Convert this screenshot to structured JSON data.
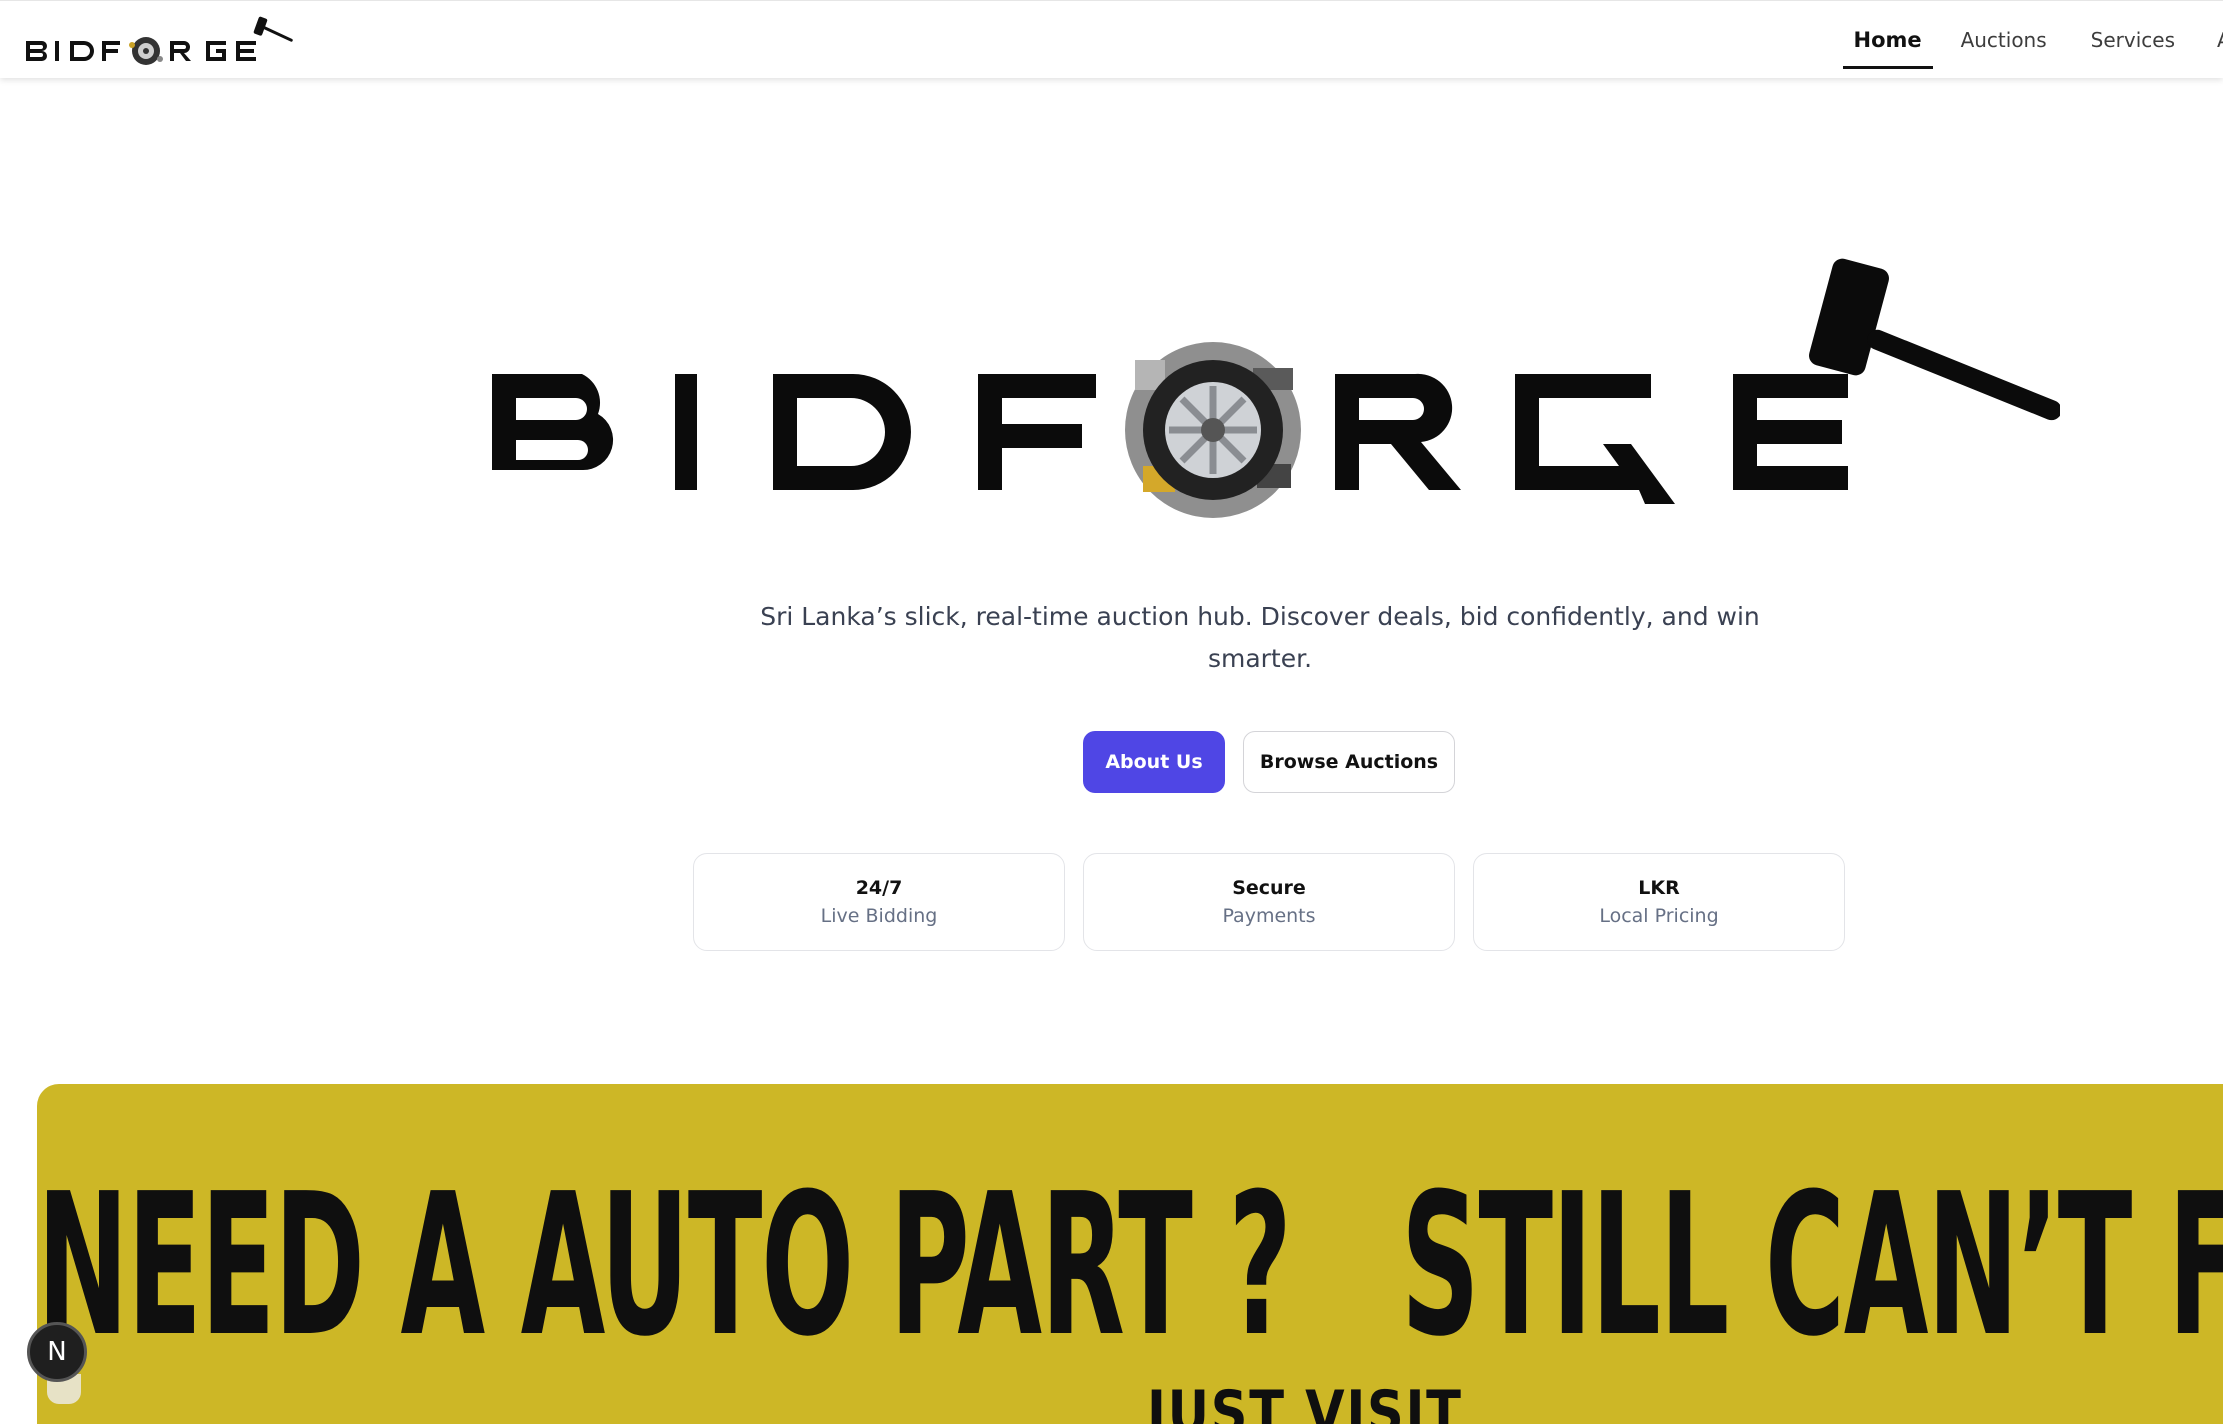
{
  "header": {
    "logo_text": "BIDFORGE",
    "nav": [
      {
        "label": "Home",
        "active": true
      },
      {
        "label": "Auctions",
        "active": false
      },
      {
        "label": "Services",
        "active": false
      },
      {
        "label": "A",
        "active": false
      }
    ]
  },
  "hero": {
    "logo_text": "BIDFORGE",
    "tagline": "Sri Lanka’s slick, real-time auction hub. Discover deals, bid confidently, and win smarter.",
    "buttons": {
      "primary": "About Us",
      "secondary": "Browse Auctions"
    },
    "stats": [
      {
        "value": "24/7",
        "label": "Live Bidding"
      },
      {
        "value": "Secure",
        "label": "Payments"
      },
      {
        "value": "LKR",
        "label": "Local Pricing"
      }
    ]
  },
  "banner": {
    "marquee_text": "NEED A AUTO PART ?   STILL CAN’T FI",
    "subtext": "JUST VISIT"
  },
  "dev_badge": {
    "letter": "N"
  },
  "colors": {
    "primary": "#4F46E5",
    "banner": "#CDB726",
    "text_dark": "#111111",
    "text_muted": "#667085"
  }
}
